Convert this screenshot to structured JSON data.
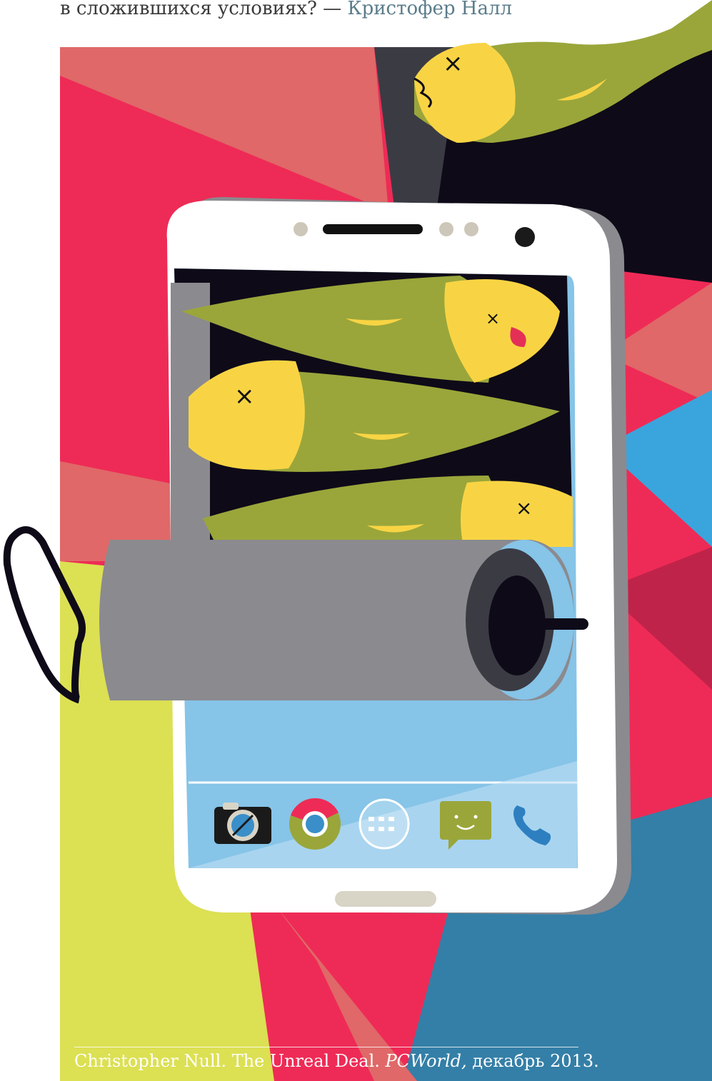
{
  "quote": {
    "text": "в сложившихся условиях? — ",
    "author": "Кристофер Налл"
  },
  "caption": {
    "author": "Christopher Null. The Unreal Deal. ",
    "publication": "PCWorld,",
    "date": " декабрь 2013."
  },
  "colors": {
    "ray_red": "#ee2b56",
    "ray_salmon": "#e06868",
    "ray_dark": "#3b3b44",
    "ray_black": "#0e0a18",
    "ray_blue": "#3aa5dc",
    "ray_teal": "#347fa7",
    "ray_yellow": "#dce053",
    "phone_white": "#ffffff",
    "phone_gray": "#8b8a8f",
    "fish_green": "#9aa63a",
    "fish_yellow": "#f8d444",
    "screen_blue": "#86c4e8"
  },
  "icons": [
    "camera-icon",
    "chrome-icon",
    "apps-grid-icon",
    "message-icon",
    "phone-call-icon"
  ]
}
